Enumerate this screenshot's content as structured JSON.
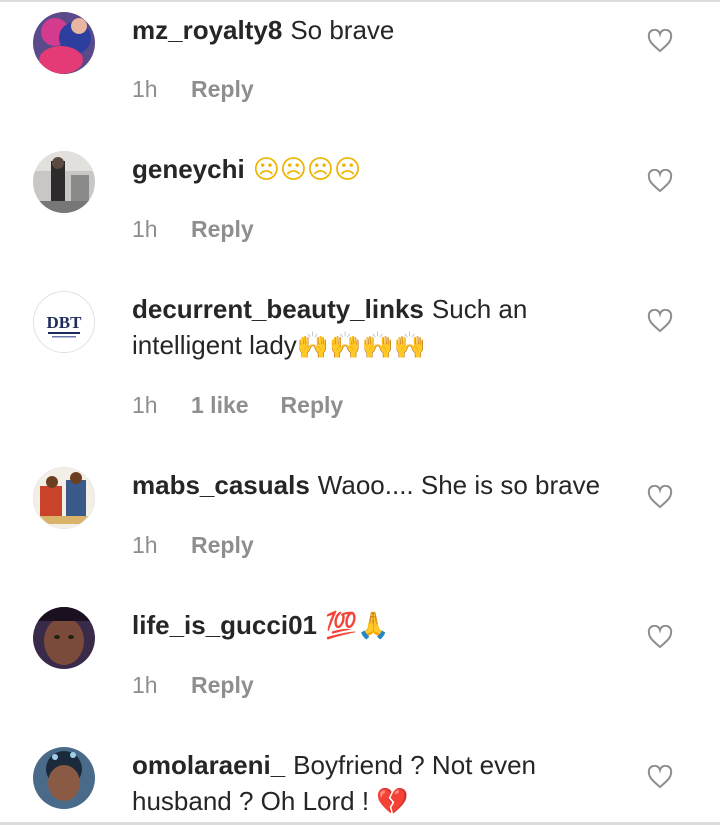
{
  "comments": [
    {
      "username": "mz_royalty8",
      "text": "So brave",
      "emoji": "",
      "time": "1h",
      "likes": "",
      "reply": "Reply"
    },
    {
      "username": "geneychi",
      "text": "",
      "emoji": "☹☹☹☹",
      "time": "1h",
      "likes": "",
      "reply": "Reply"
    },
    {
      "username": "decurrent_beauty_links",
      "text": "Such an intelligent lady",
      "emoji": "🙌🙌🙌🙌",
      "time": "1h",
      "likes": "1 like",
      "reply": "Reply"
    },
    {
      "username": "mabs_casuals",
      "text": "Waoo.... She is so brave",
      "emoji": "",
      "time": "1h",
      "likes": "",
      "reply": "Reply"
    },
    {
      "username": "life_is_gucci01",
      "text": "",
      "emoji": "💯🙏",
      "time": "1h",
      "likes": "",
      "reply": "Reply"
    },
    {
      "username": "omolaraeni_",
      "text": "Boyfriend ? Not even husband ? Oh Lord !",
      "emoji": "💔",
      "time": "",
      "likes": "",
      "reply": ""
    }
  ],
  "avatar_logo_text": "DBT",
  "icons": {
    "like": "heart-outline-icon"
  },
  "colors": {
    "text": "#262626",
    "meta": "#8e8e8e",
    "heart": "#8e8e8e",
    "divider": "#dcdcdc"
  }
}
